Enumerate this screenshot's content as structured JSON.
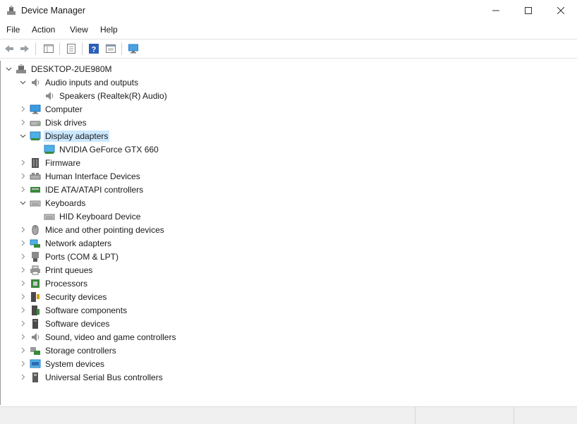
{
  "window": {
    "title": "Device Manager",
    "app_icon": "device-manager-icon"
  },
  "menu": [
    "File",
    "Action",
    "View",
    "Help"
  ],
  "toolbar": [
    {
      "name": "back-arrow-icon"
    },
    {
      "name": "forward-arrow-icon"
    },
    {
      "name": "show-hide-tree-icon"
    },
    {
      "name": "properties-icon"
    },
    {
      "name": "help-icon"
    },
    {
      "name": "action-pane-icon"
    },
    {
      "name": "monitor-icon"
    }
  ],
  "tree": {
    "root": "DESKTOP-2UE980M",
    "items": [
      {
        "label": "Audio inputs and outputs",
        "icon": "audio-icon",
        "expanded": true,
        "children": [
          {
            "label": "Speakers (Realtek(R) Audio)",
            "icon": "speaker-icon"
          }
        ]
      },
      {
        "label": "Computer",
        "icon": "computer-icon",
        "expanded": false
      },
      {
        "label": "Disk drives",
        "icon": "disk-icon",
        "expanded": false
      },
      {
        "label": "Display adapters",
        "icon": "display-adapter-icon",
        "expanded": true,
        "selected": true,
        "children": [
          {
            "label": "NVIDIA GeForce GTX 660",
            "icon": "display-adapter-icon"
          }
        ]
      },
      {
        "label": "Firmware",
        "icon": "firmware-icon",
        "expanded": false
      },
      {
        "label": "Human Interface Devices",
        "icon": "hid-icon",
        "expanded": false
      },
      {
        "label": "IDE ATA/ATAPI controllers",
        "icon": "ide-icon",
        "expanded": false
      },
      {
        "label": "Keyboards",
        "icon": "keyboard-icon",
        "expanded": true,
        "children": [
          {
            "label": "HID Keyboard Device",
            "icon": "keyboard-icon"
          }
        ]
      },
      {
        "label": "Mice and other pointing devices",
        "icon": "mouse-icon",
        "expanded": false
      },
      {
        "label": "Network adapters",
        "icon": "network-icon",
        "expanded": false
      },
      {
        "label": "Ports (COM & LPT)",
        "icon": "port-icon",
        "expanded": false
      },
      {
        "label": "Print queues",
        "icon": "printer-icon",
        "expanded": false
      },
      {
        "label": "Processors",
        "icon": "processor-icon",
        "expanded": false
      },
      {
        "label": "Security devices",
        "icon": "security-icon",
        "expanded": false
      },
      {
        "label": "Software components",
        "icon": "software-component-icon",
        "expanded": false
      },
      {
        "label": "Software devices",
        "icon": "software-device-icon",
        "expanded": false
      },
      {
        "label": "Sound, video and game controllers",
        "icon": "sound-icon",
        "expanded": false
      },
      {
        "label": "Storage controllers",
        "icon": "storage-icon",
        "expanded": false
      },
      {
        "label": "System devices",
        "icon": "system-icon",
        "expanded": false
      },
      {
        "label": "Universal Serial Bus controllers",
        "icon": "usb-icon",
        "expanded": false
      }
    ]
  },
  "colors": {
    "selection": "#cce8ff",
    "accent": "#2b7bd1"
  }
}
